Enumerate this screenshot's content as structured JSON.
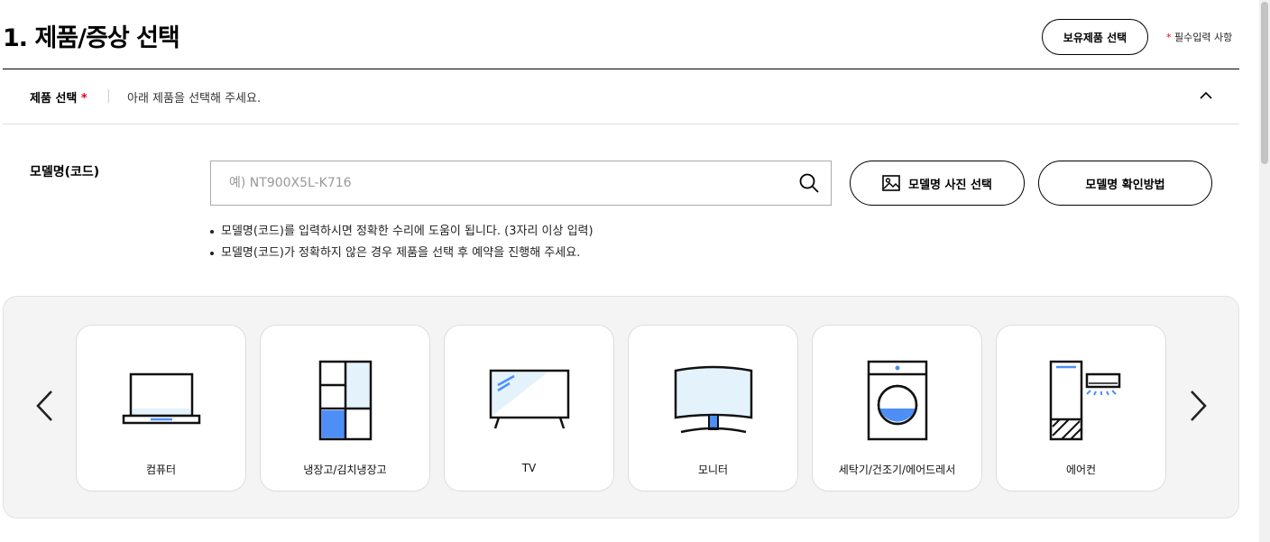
{
  "header": {
    "title": "1. 제품/증상 선택",
    "owned_button": "보유제품 선택",
    "required_star": "*",
    "required_note": " 필수입력 사항"
  },
  "product_section": {
    "label": "제품 선택",
    "required_star": "*",
    "hint": "아래 제품을 선택해 주세요."
  },
  "model": {
    "label": "모델명(코드)",
    "search_value": "",
    "search_placeholder": "예) NT900X5L-K716",
    "photo_button": "모델명 사진 선택",
    "howto_button": "모델명 확인방법",
    "notes": [
      "모델명(코드)를 입력하시면 정확한 수리에 도움이 됩니다. (3자리 이상 입력)",
      "모델명(코드)가 정확하지 않은 경우 제품을 선택 후 예약을 진행해 주세요."
    ]
  },
  "categories": [
    {
      "label": "컴퓨터",
      "icon": "laptop-icon"
    },
    {
      "label": "냉장고/김치냉장고",
      "icon": "refrigerator-icon"
    },
    {
      "label": "TV",
      "icon": "tv-icon"
    },
    {
      "label": "모니터",
      "icon": "monitor-icon"
    },
    {
      "label": "세탁기/건조기/에어드레서",
      "icon": "washing-machine-icon"
    },
    {
      "label": "에어컨",
      "icon": "air-conditioner-icon"
    }
  ],
  "colors": {
    "accent_blue": "#4d8ef7",
    "light_blue": "#e3f2fb",
    "required_red": "#e0001e"
  }
}
